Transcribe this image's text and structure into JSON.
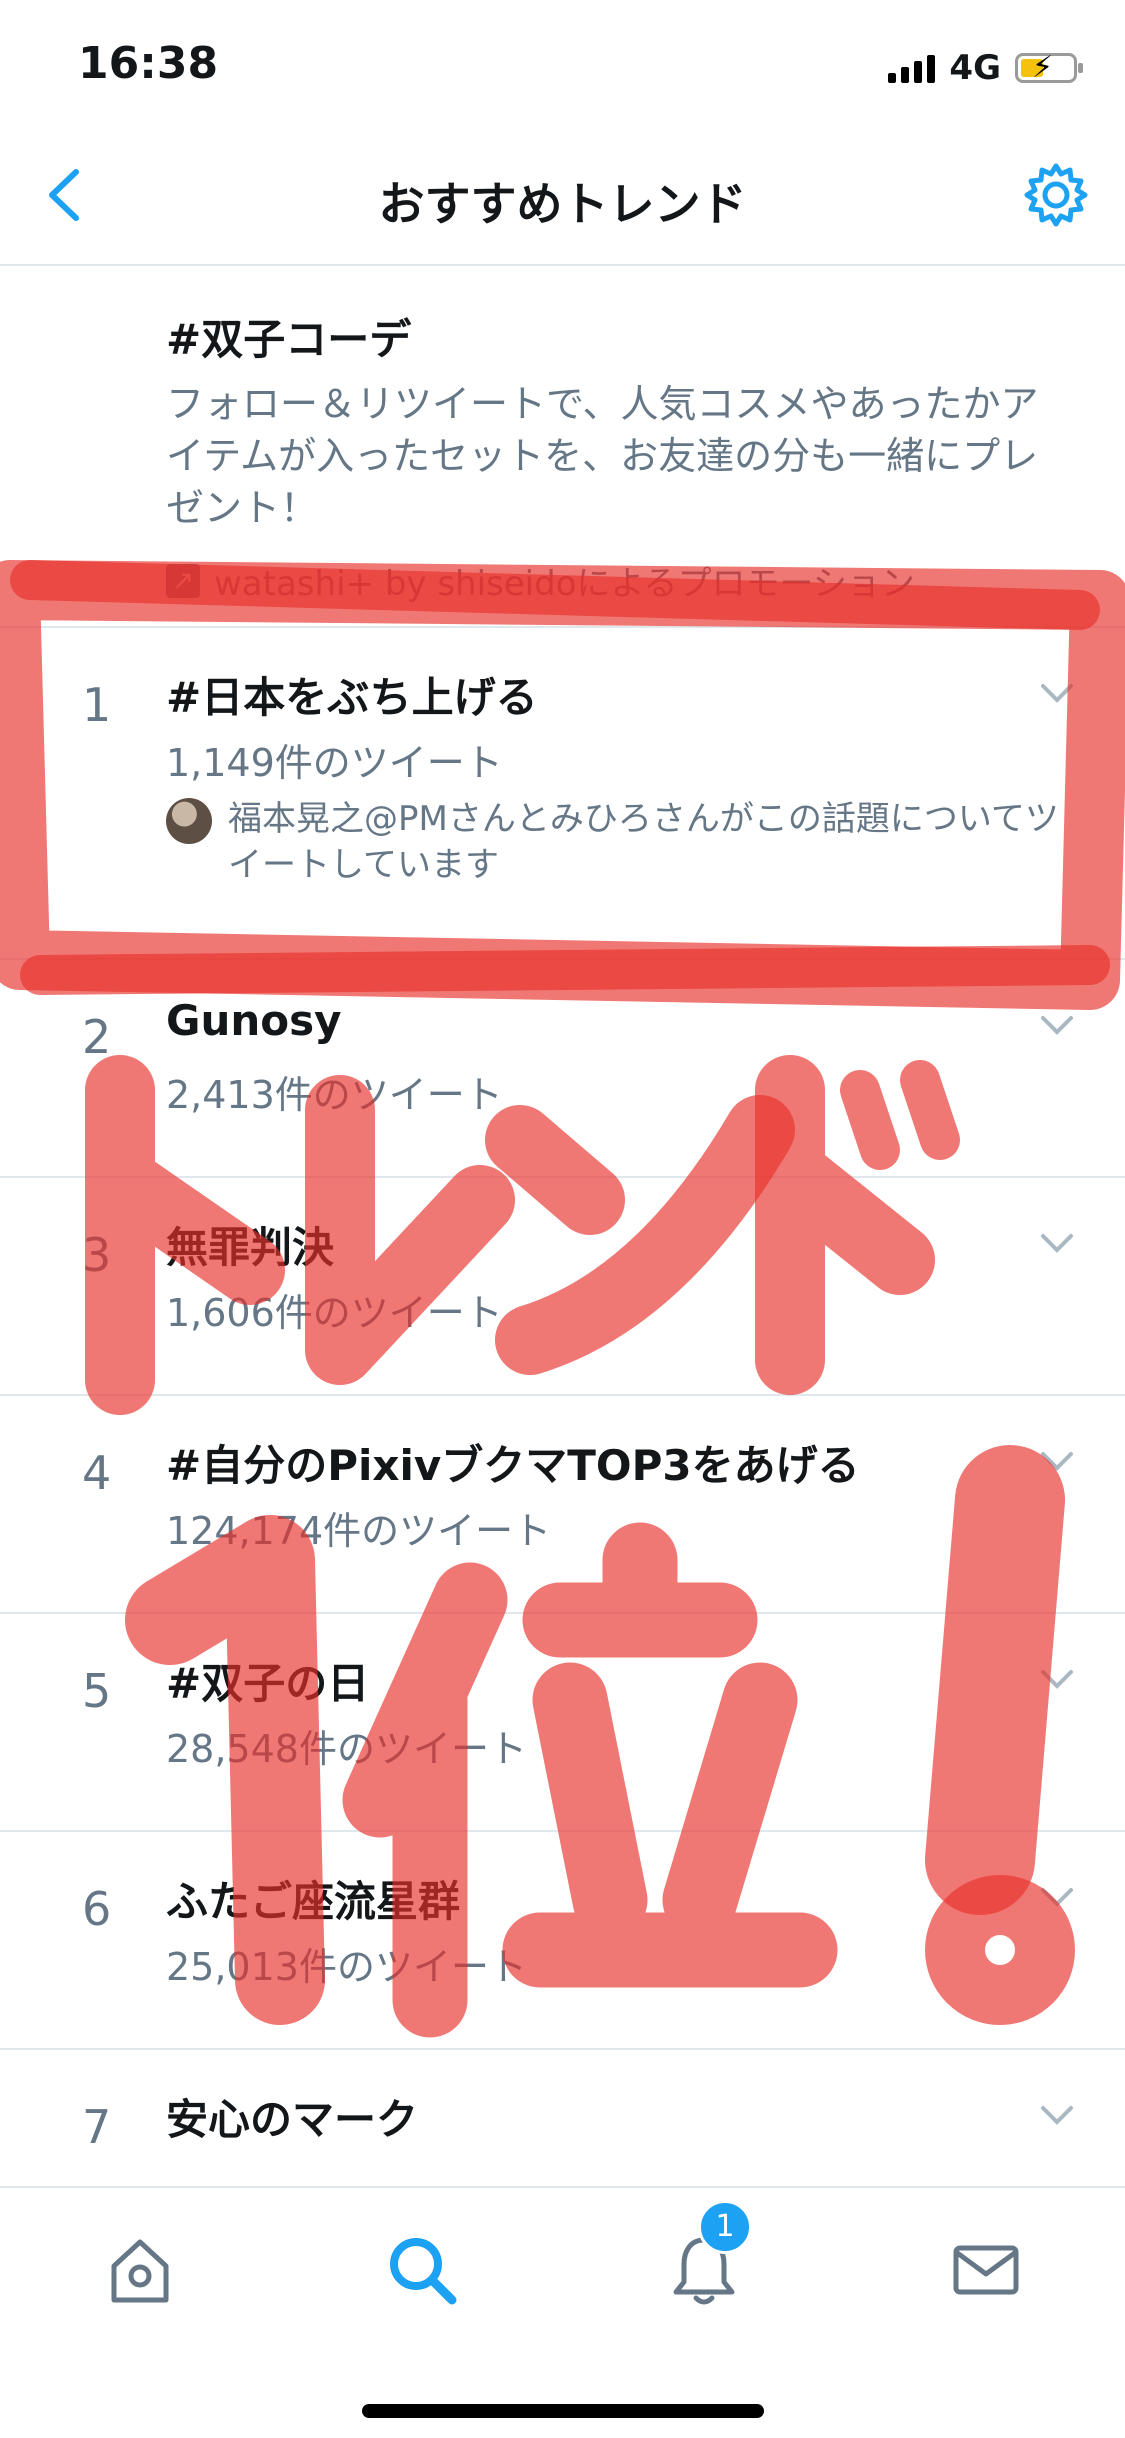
{
  "status_bar": {
    "time": "16:38",
    "network": "4G"
  },
  "header": {
    "title": "おすすめトレンド"
  },
  "promoted": {
    "title": "#双子コーデ",
    "description": "フォロー＆リツイートで、人気コスメやあったかアイテムが入ったセットを、お友達の分も一緒にプレゼント！",
    "promoted_by": "watashi+ by shiseidoによるプロモーション"
  },
  "trends": [
    {
      "rank": "1",
      "name": "#日本をぶち上げる",
      "count": "1,149件のツイート",
      "context": "福本晃之@PMさんとみひろさんがこの話題についてツイートしています"
    },
    {
      "rank": "2",
      "name": "Gunosy",
      "count": "2,413件のツイート"
    },
    {
      "rank": "3",
      "name": "無罪判決",
      "count": "1,606件のツイート"
    },
    {
      "rank": "4",
      "name": "#自分のPixivブクマTOP3をあげる",
      "count": "124,174件のツイート"
    },
    {
      "rank": "5",
      "name": "#双子の日",
      "count": "28,548件のツイート"
    },
    {
      "rank": "6",
      "name": "ふたご座流星群",
      "count": "25,013件のツイート"
    },
    {
      "rank": "7",
      "name": "安心のマーク"
    }
  ],
  "tabbar": {
    "notification_badge": "1"
  },
  "annotation": {
    "handwritten_text": "トレンド1位!",
    "color": "#e8302a"
  },
  "colors": {
    "accent": "#1da1f2",
    "secondary_text": "#657786",
    "divider": "#e1e8ed"
  }
}
